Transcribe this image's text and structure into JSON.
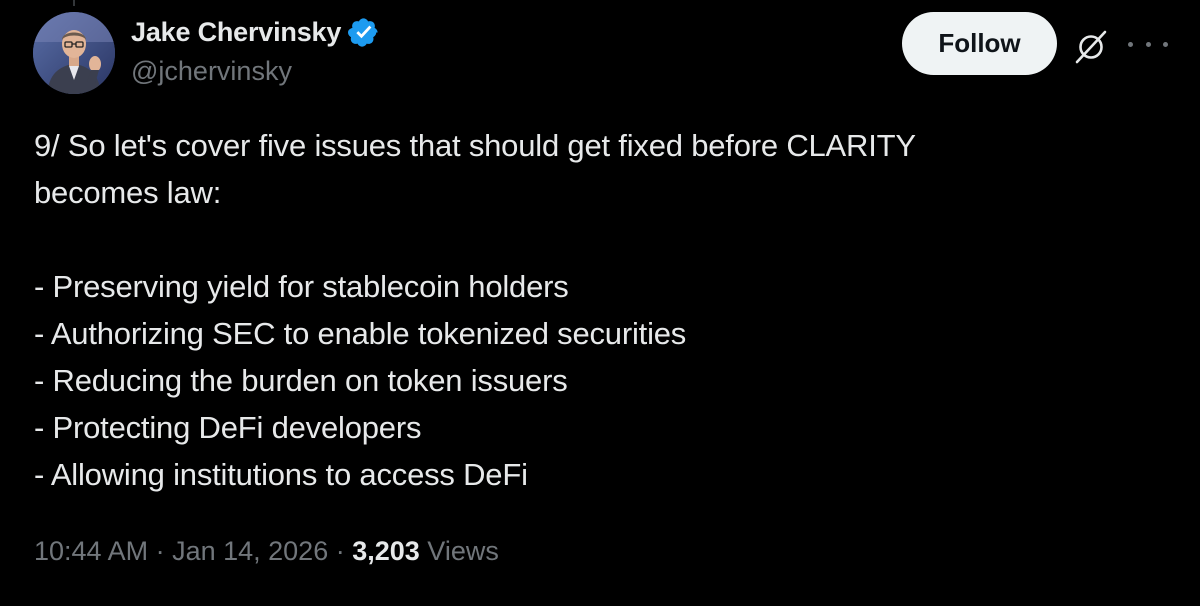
{
  "author": {
    "display_name": "Jake Chervinsky",
    "handle": "@jchervinsky",
    "verified": true,
    "verified_color": "#1d9bf0"
  },
  "actions": {
    "follow_label": "Follow",
    "grok_icon": "grok-icon",
    "more_icon": "more-options-icon"
  },
  "tweet": {
    "lines": [
      "9/ So let's cover five issues that should get fixed before CLARITY",
      "becomes law:",
      "",
      "- Preserving yield for stablecoin holders",
      "- Authorizing SEC to enable tokenized securities",
      "- Reducing the burden on token issuers",
      "- Protecting DeFi developers",
      "- Allowing institutions to access DeFi"
    ]
  },
  "meta": {
    "time": "10:44 AM",
    "separator": " · ",
    "date": "Jan 14, 2026",
    "views_count": "3,203",
    "views_label": " Views"
  },
  "colors": {
    "background": "#000000",
    "text_primary": "#e7e9ea",
    "text_secondary": "#71767b",
    "follow_bg": "#eff3f4"
  }
}
